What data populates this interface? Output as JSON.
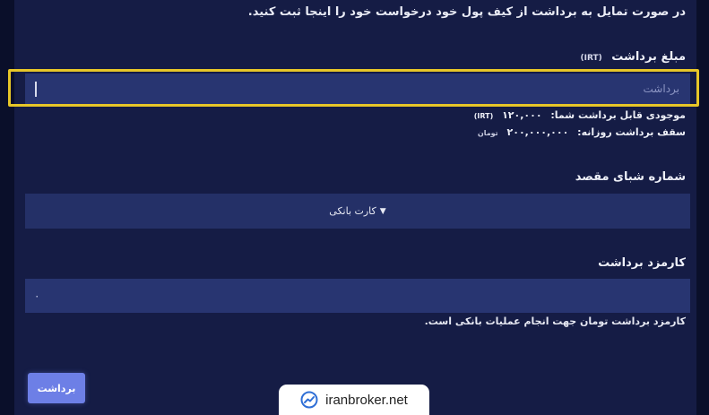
{
  "intro_text": "در صورت تمایل به برداشت از کیف پول خود درخواست خود را اینجا ثبت کنید.",
  "amount": {
    "label": "مبلغ برداشت",
    "unit": "(IRT)",
    "placeholder": "برداشت",
    "value": ""
  },
  "balance": {
    "label": "موجودی قابل برداشت شما:",
    "value": "۱۲۰,۰۰۰",
    "unit": "(IRT)"
  },
  "daily_limit": {
    "label": "سقف برداشت روزانه:",
    "value": "۲۰۰,۰۰۰,۰۰۰",
    "unit": "تومان"
  },
  "sheba": {
    "label": "شماره شبای مقصد",
    "selected": "کارت بانکی"
  },
  "fee": {
    "label": "کارمزد برداشت",
    "value": "۰",
    "note": "کارمزد برداشت تومان جهت انجام عملیات بانکی است."
  },
  "submit_label": "برداشت",
  "watermark": "iranbroker.net",
  "colors": {
    "background": "#151c45",
    "input": "#283571",
    "highlight": "#e7c628",
    "button": "#6d7fe6"
  }
}
